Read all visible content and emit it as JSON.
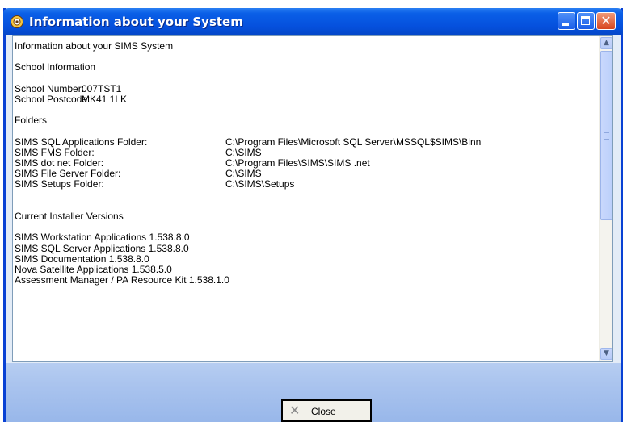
{
  "window": {
    "title": "Information about your System",
    "accent": "#0550dd"
  },
  "content": {
    "heading": "Information about your SIMS System",
    "school_section": "School Information",
    "school": [
      {
        "label": "School Number:",
        "value": "007TST1"
      },
      {
        "label": "School Postcode:",
        "value": "MK41 1LK"
      }
    ],
    "folders_section": "Folders",
    "folders": [
      {
        "label": "SIMS SQL Applications Folder:",
        "value": "C:\\Program Files\\Microsoft SQL Server\\MSSQL$SIMS\\Binn"
      },
      {
        "label": "SIMS FMS Folder:",
        "value": "C:\\SIMS"
      },
      {
        "label": "SIMS dot net Folder:",
        "value": "C:\\Program Files\\SIMS\\SIMS .net"
      },
      {
        "label": "SIMS File Server Folder:",
        "value": "C:\\SIMS"
      },
      {
        "label": "SIMS Setups Folder:",
        "value": "C:\\SIMS\\Setups"
      }
    ],
    "installer_section": "Current Installer Versions",
    "installers": [
      "SIMS Workstation Applications 1.538.8.0",
      "SIMS SQL Server Applications 1.538.8.0",
      "SIMS Documentation 1.538.8.0",
      "Nova Satellite Applications 1.538.5.0",
      "Assessment Manager / PA Resource Kit 1.538.1.0"
    ]
  },
  "footer": {
    "close_label": "Close"
  },
  "icons": {
    "title_icon": "gear-icon",
    "close_button_icon": "close-x-icon"
  }
}
